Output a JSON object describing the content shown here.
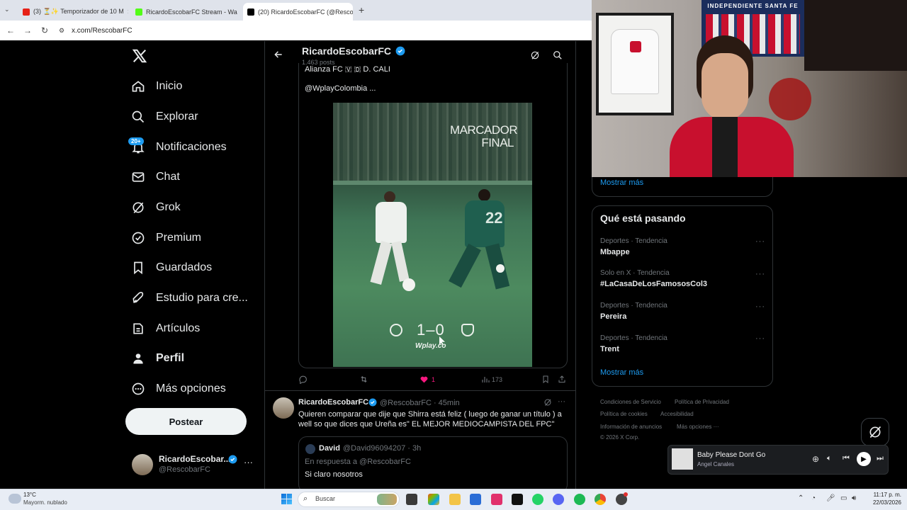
{
  "browser": {
    "tabs": [
      {
        "label": "(3) ⏳✨ Temporizador de 10 M",
        "active": false
      },
      {
        "label": "RicardoEscobarFC Stream - Wa",
        "active": false
      },
      {
        "label": "(20) RicardoEscobarFC (@Resco",
        "active": true
      }
    ],
    "new_tab": "+",
    "url": "x.com/RescobarFC"
  },
  "nav": {
    "items": [
      "Inicio",
      "Explorar",
      "Notificaciones",
      "Chat",
      "Grok",
      "Premium",
      "Guardados",
      "Estudio para cre...",
      "Artículos",
      "Perfil",
      "Más opciones"
    ],
    "notif_badge": "20+",
    "post_button": "Postear",
    "account_name": "RicardoEscobar...",
    "account_handle": "@RescobarFC"
  },
  "profile_header": {
    "name": "RicardoEscobarFC",
    "posts": "1.463 posts"
  },
  "tweet1": {
    "text_top": "Alianza FC 🇻 🇩 D. CALI",
    "mention": "@WplayColombia ...",
    "image_title_1": "MARCADOR",
    "image_title_2": "FINAL",
    "score": "1–0",
    "sponsor": "Wplay.co",
    "jersey": "22",
    "likes": "1",
    "views": "173"
  },
  "tweet2": {
    "name": "RicardoEscobarFC",
    "handle": "@RescobarFC · 45min",
    "text": "Quieren comparar que dije que Shirra está feliz ( luego de ganar un título ) a well so que dices que Ureña es\" EL MEJOR MEDIOCAMPISTA DEL FPC\"",
    "quote_name": "David",
    "quote_handle": "@David96094207 · 3h",
    "quote_reply": "En respuesta a @RescobarFC",
    "quote_text": "Si claro nosotros"
  },
  "right": {
    "show_more_top": "Mostrar más",
    "trending_title": "Qué está pasando",
    "trends": [
      {
        "meta": "Deportes · Tendencia",
        "name": "Mbappe"
      },
      {
        "meta": "Solo en X · Tendencia",
        "name": "#LaCasaDeLosFamososCol3"
      },
      {
        "meta": "Deportes · Tendencia",
        "name": "Pereira"
      },
      {
        "meta": "Deportes · Tendencia",
        "name": "Trent"
      }
    ],
    "show_more": "Mostrar más",
    "footer": [
      "Condiciones de Servicio",
      "Política de Privacidad",
      "Política de cookies",
      "Accesibilidad",
      "Información de anuncios",
      "Más opciones ···",
      "© 2026 X Corp."
    ]
  },
  "webcam": {
    "banner_text": "INDEPENDIENTE SANTA FE"
  },
  "media_player": {
    "title": "Baby Please Dont Go",
    "artist": "Angel Canales"
  },
  "taskbar": {
    "weather_temp": "13°C",
    "weather_desc": "Mayorm. nublado",
    "search": "Buscar",
    "time": "11:17 p. m.",
    "date": "22/03/2026"
  },
  "colors": {
    "accent": "#1d9bf0",
    "like": "#f91880",
    "bg": "#000000"
  }
}
